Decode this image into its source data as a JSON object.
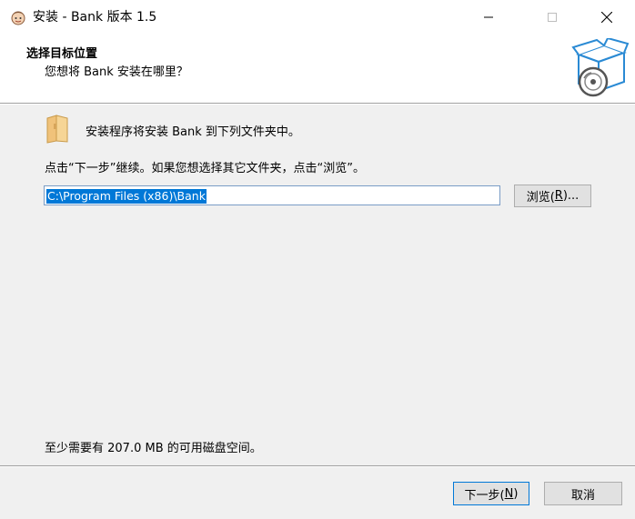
{
  "window": {
    "title": "安装 - Bank 版本 1.5",
    "app_icon": "installer-face-icon",
    "controls": [
      "minimize-icon",
      "maximize-icon",
      "close-icon"
    ]
  },
  "header": {
    "title": "选择目标位置",
    "subtitle": "您想将 Bank 安装在哪里？",
    "image": "software-box-cd-icon"
  },
  "body": {
    "folder_icon": "folder-icon",
    "info_text": "安装程序将安装 Bank 到下列文件夹中。",
    "instruction_text": "点击“下一步”继续。如果您想选择其它文件夹，点击“浏览”。",
    "directory_value": "C:\\Program Files (x86)\\Bank",
    "browse_label_pre": "浏览(",
    "browse_label_key": "R",
    "browse_label_post": ")...",
    "space_text": "至少需要有 207.0 MB 的可用磁盘空间。"
  },
  "footer": {
    "next_label_pre": "下一步(",
    "next_label_key": "N",
    "next_label_post": ")",
    "cancel_label": "取消"
  },
  "colors": {
    "accent": "#0078d7",
    "face": "#f0f0f0",
    "button": "#e1e1e1"
  }
}
